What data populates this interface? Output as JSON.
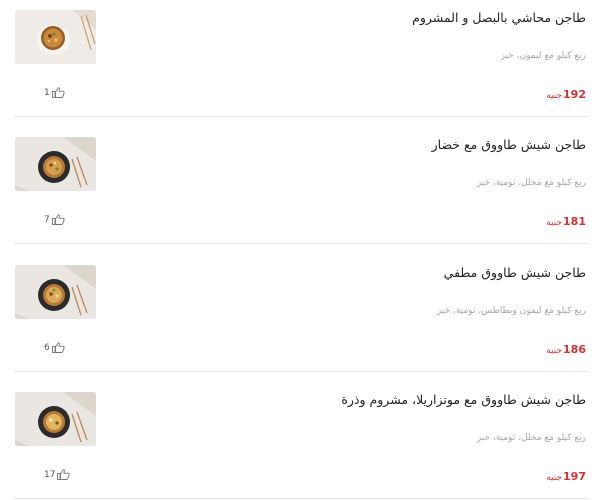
{
  "currency": "جنيه",
  "items": [
    {
      "title": "طاجن محاشي بالبصل و المشروم",
      "description": "ربع كيلو مع ليمون، خبز",
      "price": "192",
      "likes": "1",
      "image_icon": "tagine-dish-photo"
    },
    {
      "title": "طاجن شيش طاووق مع خضار",
      "description": "ربع كيلو مع مخلل، ثومية، خبز",
      "price": "181",
      "likes": "7",
      "image_icon": "tagine-dish-photo"
    },
    {
      "title": "طاجن شيش طاووق مطفي",
      "description": "ربع كيلو مع ليمون وبطاطس، ثومية، خبز",
      "price": "186",
      "likes": "6",
      "image_icon": "tagine-dish-photo"
    },
    {
      "title": "طاجن شيش طاووق مع موتزاريلا، مشروم وذرة",
      "description": "ربع كيلو مع مخلل، ثومية، خبز",
      "price": "197",
      "likes": "17",
      "image_icon": "tagine-dish-photo"
    }
  ],
  "colors": {
    "price": "#d43232",
    "title": "#222222",
    "description": "#a8a8a8",
    "divider": "#e6e6e6"
  }
}
